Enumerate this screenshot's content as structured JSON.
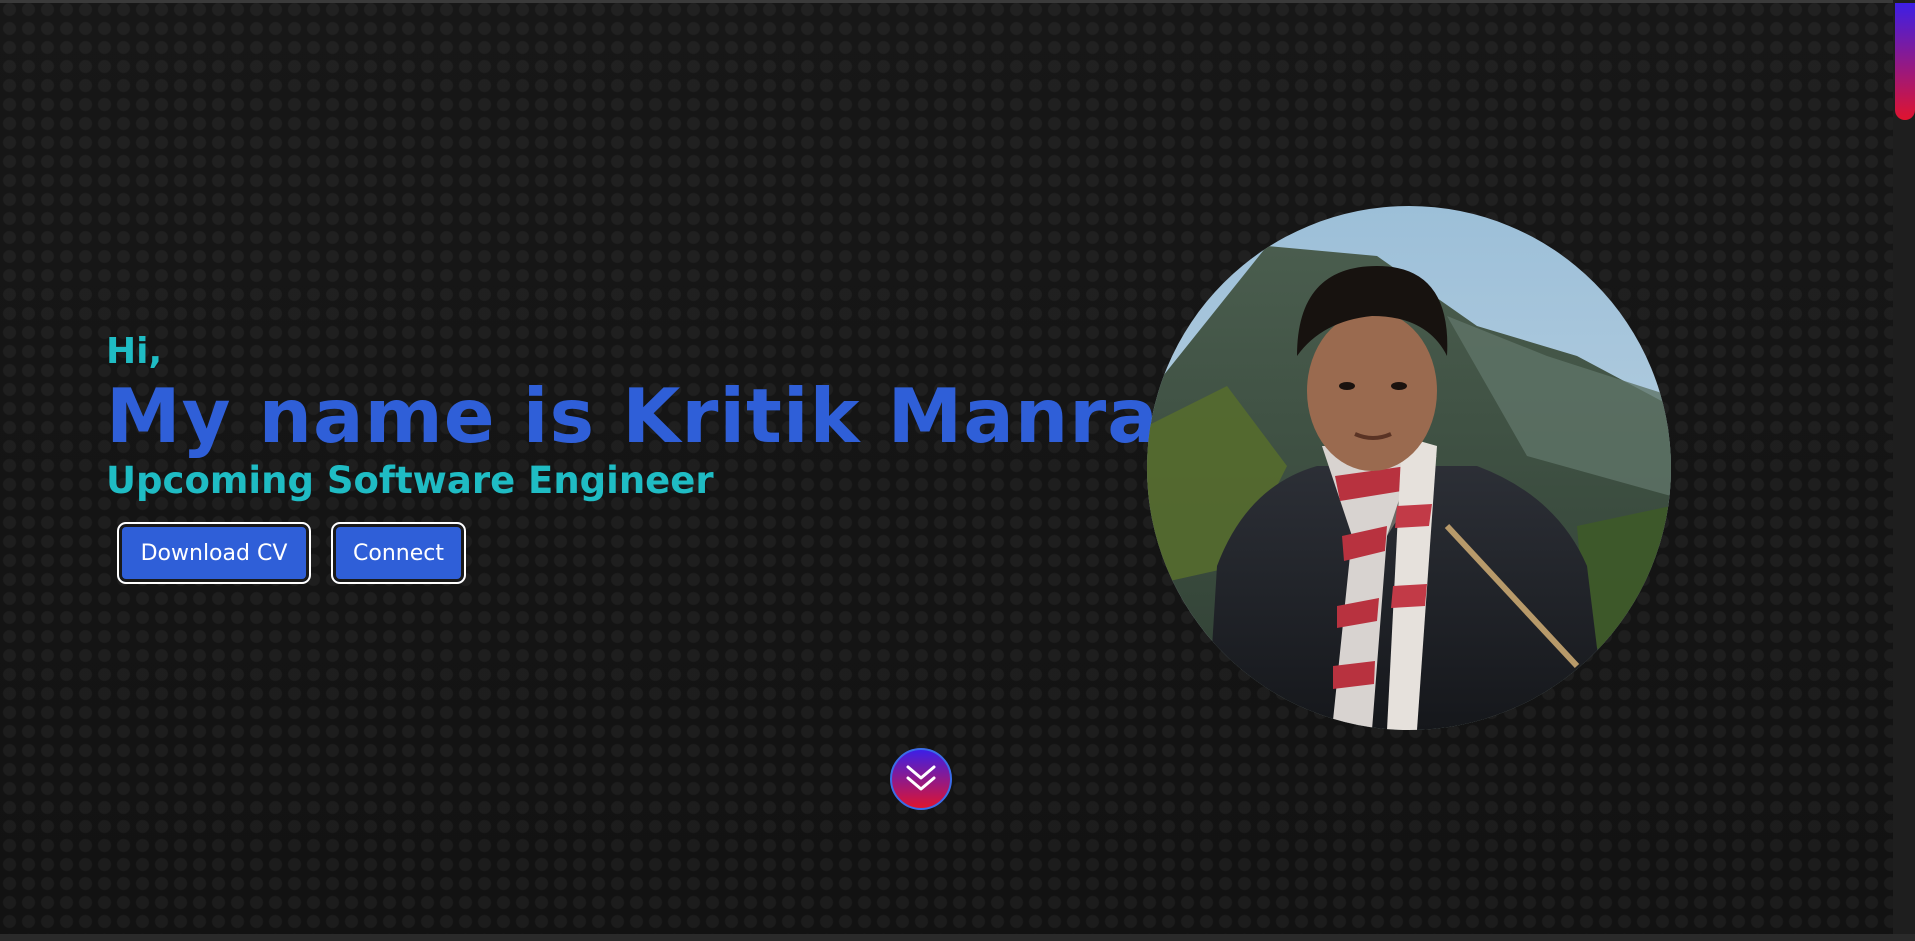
{
  "hero": {
    "greeting": "Hi,",
    "name": "My name is Kritik Manral",
    "role": "Upcoming Software Engineer",
    "buttons": {
      "download_cv": "Download CV",
      "connect": "Connect"
    }
  },
  "portrait": {
    "alt": "Portrait photo of Kritik Manral with mountains in background"
  },
  "scroll_down": {
    "icon": "double-chevron-down-icon"
  },
  "colors": {
    "accent_teal": "#1fbcc4",
    "accent_blue": "#2f5fd8",
    "gradient_top": "#3d1fe6",
    "gradient_bottom": "#e0142f",
    "background": "#151515"
  }
}
